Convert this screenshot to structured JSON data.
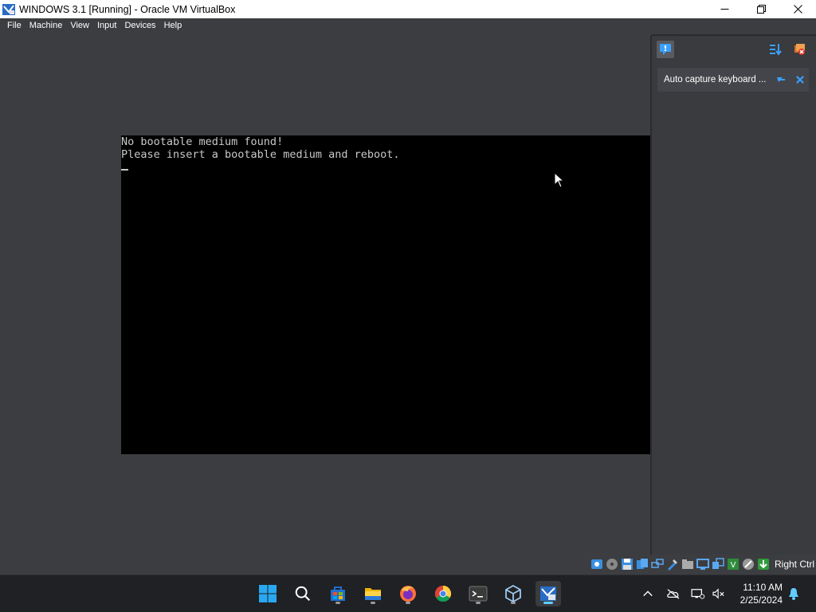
{
  "window": {
    "title": "WINDOWS 3.1 [Running] - Oracle VM VirtualBox"
  },
  "menu": {
    "items": [
      "File",
      "Machine",
      "View",
      "Input",
      "Devices",
      "Help"
    ]
  },
  "vm": {
    "line1": "No bootable medium found!",
    "line2": "Please insert a bootable medium and reboot."
  },
  "notification_panel": {
    "message": "Auto capture keyboard ..."
  },
  "statusbar": {
    "host_key": "Right Ctrl",
    "icons": [
      "hard-disk-icon",
      "optical-drive-icon",
      "floppy-icon",
      "audio-icon",
      "network-icon",
      "usb-icon",
      "shared-folders-icon",
      "display-icon",
      "recording-icon",
      "vm-cpu-icon",
      "mouse-integration-icon",
      "host-key-icon"
    ]
  },
  "taskbar": {
    "apps": [
      "start-icon",
      "search-icon",
      "store-icon",
      "file-explorer-icon",
      "firefox-icon",
      "chrome-icon",
      "terminal-icon",
      "virtualbox-icon",
      "vm-window-icon"
    ],
    "time": "11:10 AM",
    "date": "2/25/2024"
  },
  "colors": {
    "background": "#3c3d40",
    "vm_screen": "#000000",
    "taskbar": "#202124",
    "accent": "#60cdff"
  }
}
